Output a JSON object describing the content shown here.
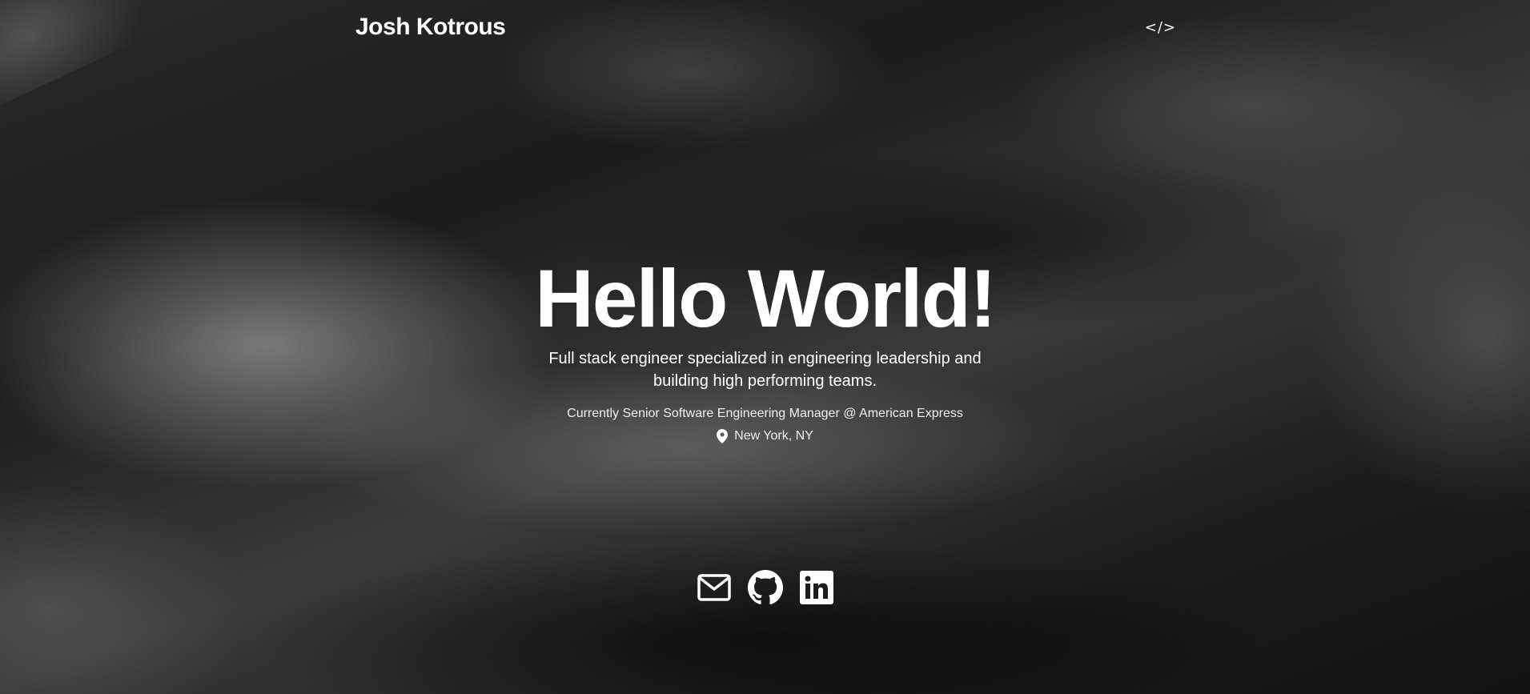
{
  "header": {
    "brand": "Josh Kotrous",
    "code_link": "</>"
  },
  "hero": {
    "title": "Hello World!",
    "tagline": "Full stack engineer specialized in engineering leadership and building high performing teams.",
    "role": "Currently Senior Software Engineering Manager @ American Express",
    "location": "New York, NY"
  },
  "socials": [
    {
      "icon": "mail-icon"
    },
    {
      "icon": "github-icon"
    },
    {
      "icon": "linkedin-icon"
    }
  ]
}
